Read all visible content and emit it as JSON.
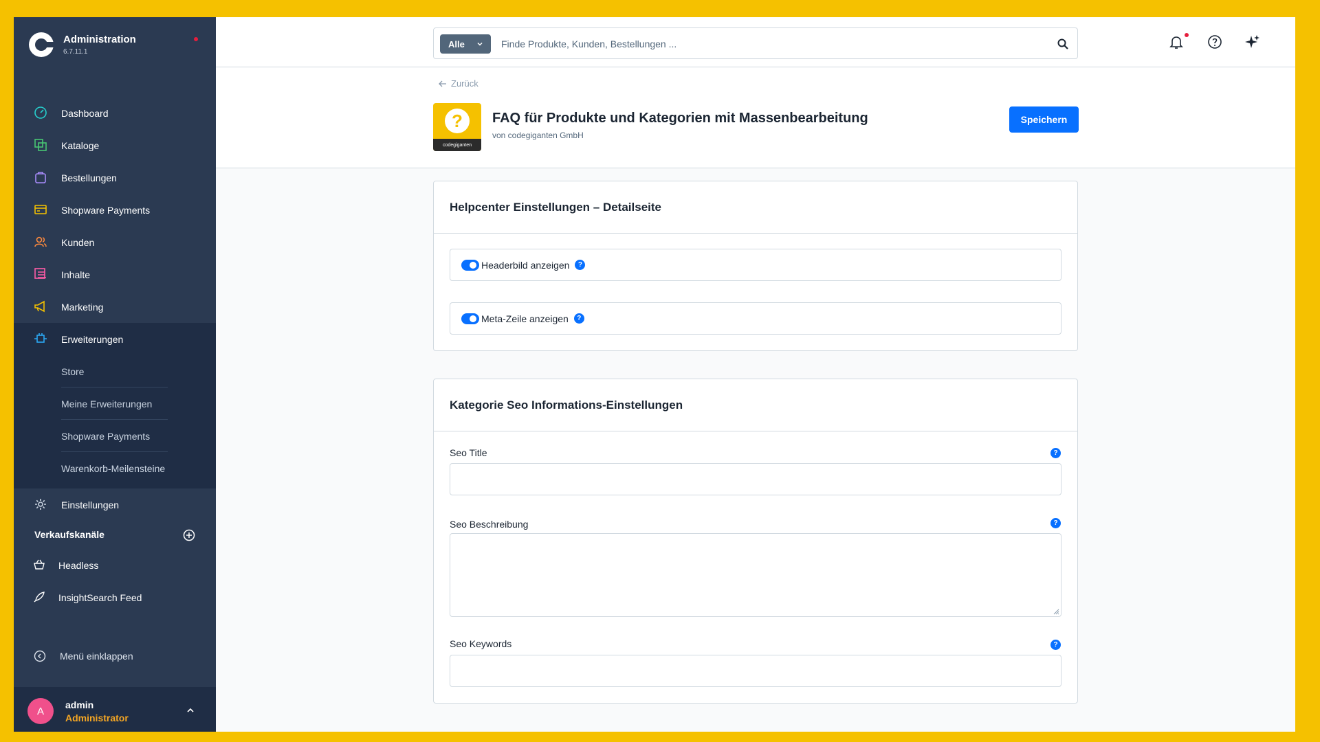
{
  "brand": {
    "title": "Administration",
    "version": "6.7.11.1"
  },
  "nav": {
    "items": [
      {
        "label": "Dashboard"
      },
      {
        "label": "Kataloge"
      },
      {
        "label": "Bestellungen"
      },
      {
        "label": "Shopware Payments"
      },
      {
        "label": "Kunden"
      },
      {
        "label": "Inhalte"
      },
      {
        "label": "Marketing"
      },
      {
        "label": "Erweiterungen"
      }
    ],
    "sub_items": [
      {
        "label": "Store"
      },
      {
        "label": "Meine Erweiterungen"
      },
      {
        "label": "Shopware Payments"
      },
      {
        "label": "Warenkorb-Meilensteine"
      }
    ],
    "settings_label": "Einstellungen"
  },
  "channels": {
    "heading": "Verkaufskanäle",
    "items": [
      {
        "label": "Headless"
      },
      {
        "label": "InsightSearch Feed"
      }
    ]
  },
  "collapse_label": "Menü einklappen",
  "user": {
    "initial": "A",
    "name": "admin",
    "role": "Administrator"
  },
  "search": {
    "filter_label": "Alle",
    "placeholder": "Finde Produkte, Kunden, Bestellungen ..."
  },
  "header": {
    "back_label": "Zurück",
    "plugin_title": "FAQ für Produkte und Kategorien mit Massenbearbeitung",
    "vendor": "von codegiganten GmbH",
    "save_label": "Speichern",
    "icon_strip_text": "codegiganten"
  },
  "card_helpcenter": {
    "title": "Helpcenter Einstellungen – Detailseite",
    "fields": [
      {
        "label": "Headerbild anzeigen",
        "enabled": true
      },
      {
        "label": "Meta-Zeile anzeigen",
        "enabled": true
      }
    ]
  },
  "card_seo": {
    "title": "Kategorie Seo Informations-Einstellungen",
    "fields": [
      {
        "label": "Seo Title",
        "value": ""
      },
      {
        "label": "Seo Beschreibung",
        "value": ""
      },
      {
        "label": "Seo Keywords",
        "value": ""
      }
    ]
  },
  "colors": {
    "primary": "#0870ff",
    "sidebar": "#2b3a52",
    "frame": "#f5c100",
    "accent_role": "#f5a623"
  }
}
